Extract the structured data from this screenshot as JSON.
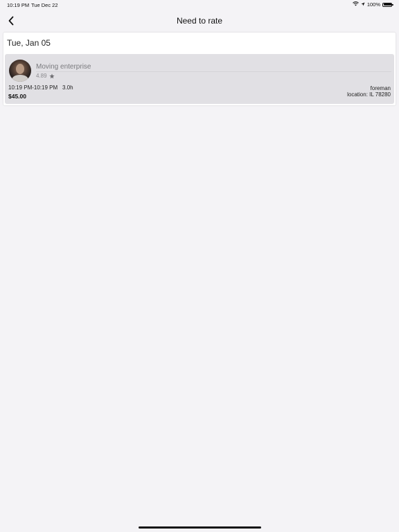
{
  "status_bar": {
    "time": "10:19 PM",
    "date": "Tue Dec 22",
    "battery": "100%",
    "battery_level": 1.0
  },
  "nav": {
    "title": "Need to rate"
  },
  "section": {
    "date_header": "Tue, Jan 05"
  },
  "job": {
    "company_name": "Moving enterprise",
    "rating": "4.89",
    "time_range": "10:19 PM-10:19 PM",
    "duration": "3.0h",
    "price": "$45.00",
    "role": "foreman",
    "location": "location: IL 78280"
  },
  "colors": {
    "background": "#f4f3f6",
    "card": "#e1e0e4",
    "panel": "#ffffff"
  }
}
